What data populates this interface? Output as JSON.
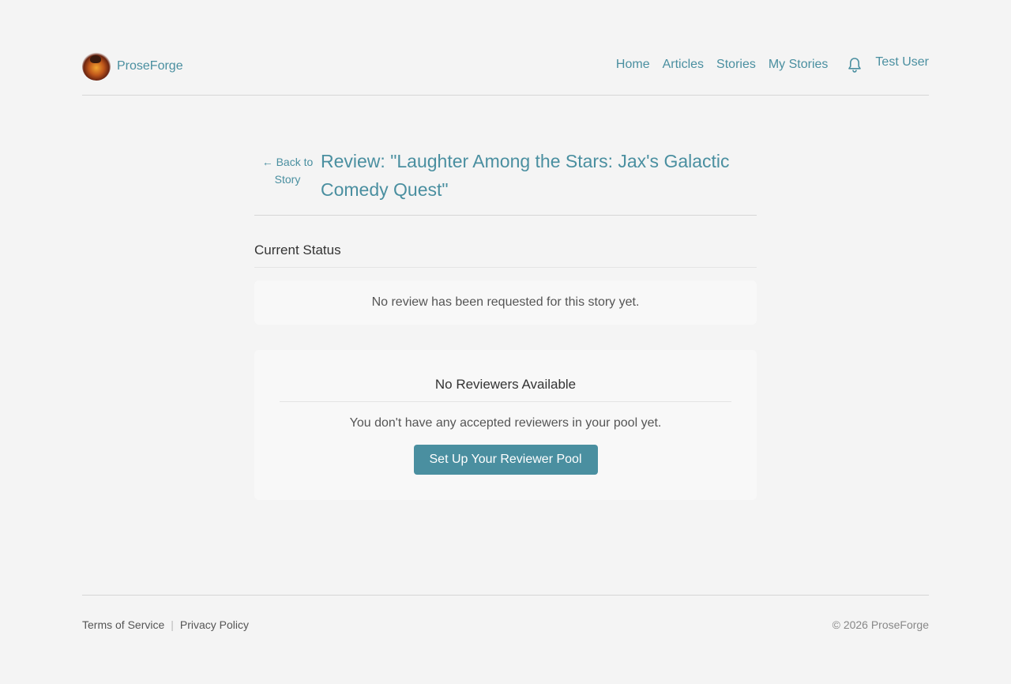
{
  "header": {
    "brand_name": "ProseForge",
    "nav": {
      "home": "Home",
      "articles": "Articles",
      "stories": "Stories",
      "my_stories": "My Stories"
    },
    "user_name": "Test User"
  },
  "main": {
    "back_link": "← Back to Story",
    "title": "Review: \"Laughter Among the Stars: Jax's Galactic Comedy Quest\"",
    "status_heading": "Current Status",
    "status_message": "No review has been requested for this story yet.",
    "reviewers_card": {
      "title": "No Reviewers Available",
      "message": "You don't have any accepted reviewers in your pool yet.",
      "button_label": "Set Up Your Reviewer Pool"
    }
  },
  "footer": {
    "terms": "Terms of Service",
    "separator": "|",
    "privacy": "Privacy Policy",
    "copyright": "© 2026 ProseForge"
  },
  "icons": {
    "logo": "proseforge-logo",
    "notifications": "bell-icon"
  },
  "colors": {
    "accent": "#4a8fa0",
    "background": "#f4f4f4",
    "card": "#f8f8f8"
  }
}
